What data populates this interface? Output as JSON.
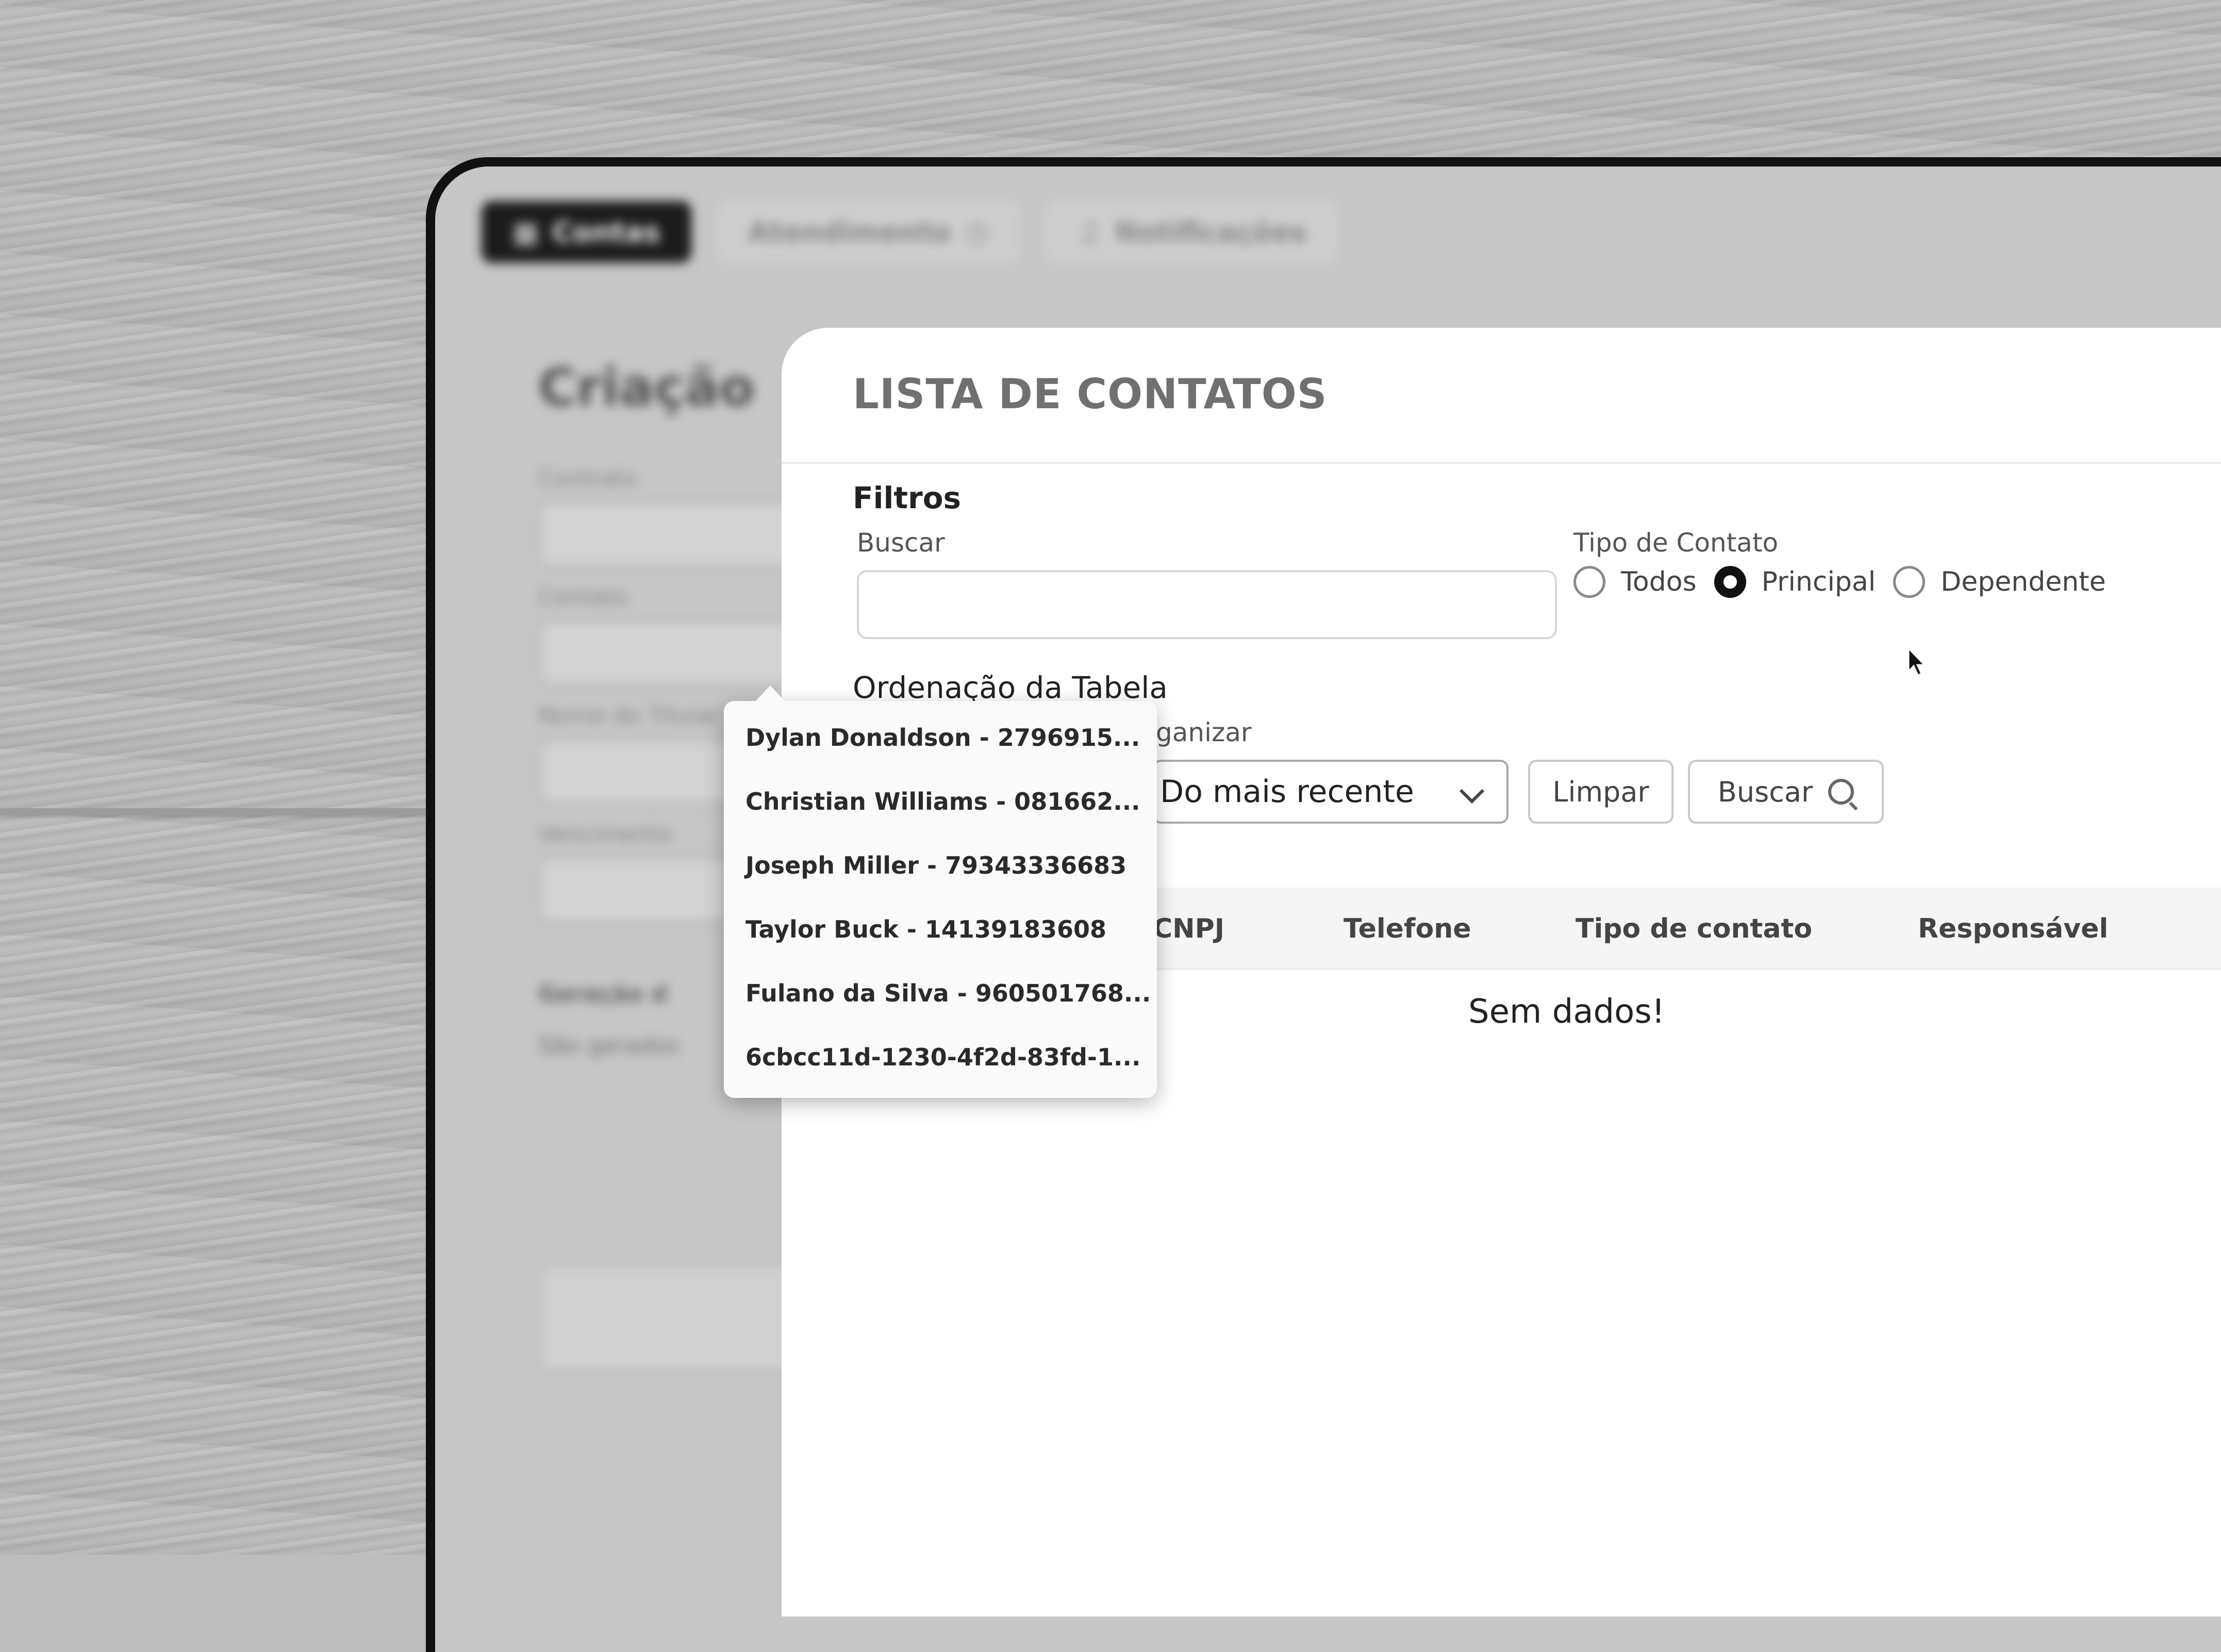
{
  "background_app": {
    "tabs": [
      {
        "label": "Contas",
        "icon": "grid-icon",
        "active": true
      },
      {
        "label": "Atendimento",
        "icon": "clock-icon",
        "active": false
      },
      {
        "label": "Notificações",
        "icon": "bell-icon",
        "active": false
      }
    ],
    "title": "Criação",
    "labels": [
      "Contrato",
      "Contato",
      "Nome do Titular",
      "Vencimento",
      "Geração d",
      "São gerados"
    ]
  },
  "modal": {
    "title": "LISTA DE CONTATOS",
    "filters_heading": "Filtros",
    "search_label": "Buscar",
    "search_value": "",
    "contact_type_label": "Tipo de Contato",
    "contact_types": [
      {
        "label": "Todos",
        "checked": false
      },
      {
        "label": "Principal",
        "checked": true
      },
      {
        "label": "Dependente",
        "checked": false
      }
    ],
    "ordering_heading": "Ordenação da Tabela",
    "organize_label": "ganizar",
    "organize_value": "Do mais recente",
    "clear_button": "Limpar",
    "search_button": "Buscar",
    "table_columns": [
      "CNPJ",
      "Telefone",
      "Tipo de contato",
      "Responsável"
    ],
    "empty_message": "Sem dados!"
  },
  "autocomplete": {
    "items": [
      "Dylan Donaldson - 2796915...",
      "Christian Williams - 081662...",
      "Joseph Miller - 79343336683",
      "Taylor Buck - 14139183608",
      "Fulano da Silva - 960501768...",
      "6cbcc11d-1230-4f2d-83fd-1..."
    ]
  }
}
